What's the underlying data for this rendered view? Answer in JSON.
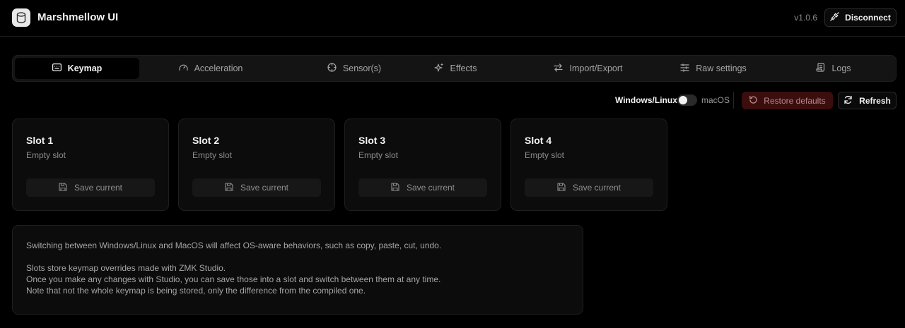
{
  "header": {
    "title": "Marshmellow UI",
    "version": "v1.0.6",
    "disconnect_label": "Disconnect"
  },
  "tabs": [
    {
      "label": "Keymap",
      "icon": "keyboard-icon",
      "active": true
    },
    {
      "label": "Acceleration",
      "icon": "gauge-icon",
      "active": false
    },
    {
      "label": "Sensor(s)",
      "icon": "crosshair-icon",
      "active": false
    },
    {
      "label": "Effects",
      "icon": "sparkles-icon",
      "active": false
    },
    {
      "label": "Import/Export",
      "icon": "arrows-swap-icon",
      "active": false
    },
    {
      "label": "Raw settings",
      "icon": "sliders-icon",
      "active": false
    },
    {
      "label": "Logs",
      "icon": "scroll-icon",
      "active": false
    }
  ],
  "toolbar": {
    "os_left": "Windows/Linux",
    "os_right": "macOS",
    "os_selected": "Windows/Linux",
    "restore_label": "Restore defaults",
    "refresh_label": "Refresh"
  },
  "slots": [
    {
      "title": "Slot 1",
      "status": "Empty slot",
      "save_label": "Save current"
    },
    {
      "title": "Slot 2",
      "status": "Empty slot",
      "save_label": "Save current"
    },
    {
      "title": "Slot 3",
      "status": "Empty slot",
      "save_label": "Save current"
    },
    {
      "title": "Slot 4",
      "status": "Empty slot",
      "save_label": "Save current"
    }
  ],
  "info": {
    "line1": "Switching between Windows/Linux and MacOS will affect OS-aware behaviors, such as copy, paste, cut, undo.",
    "line2": "Slots store keymap overrides made with ZMK Studio.",
    "line3": "Once you make any changes with Studio, you can save those into a slot and switch between them at any time.",
    "line4": "Note that not the whole keymap is being stored, only the difference from the compiled one."
  },
  "colors": {
    "background": "#000000",
    "card": "#0c0c0c",
    "danger_bg": "#3b0d0d",
    "text_primary": "#f2f2f2",
    "text_muted": "#8c8c8c"
  }
}
